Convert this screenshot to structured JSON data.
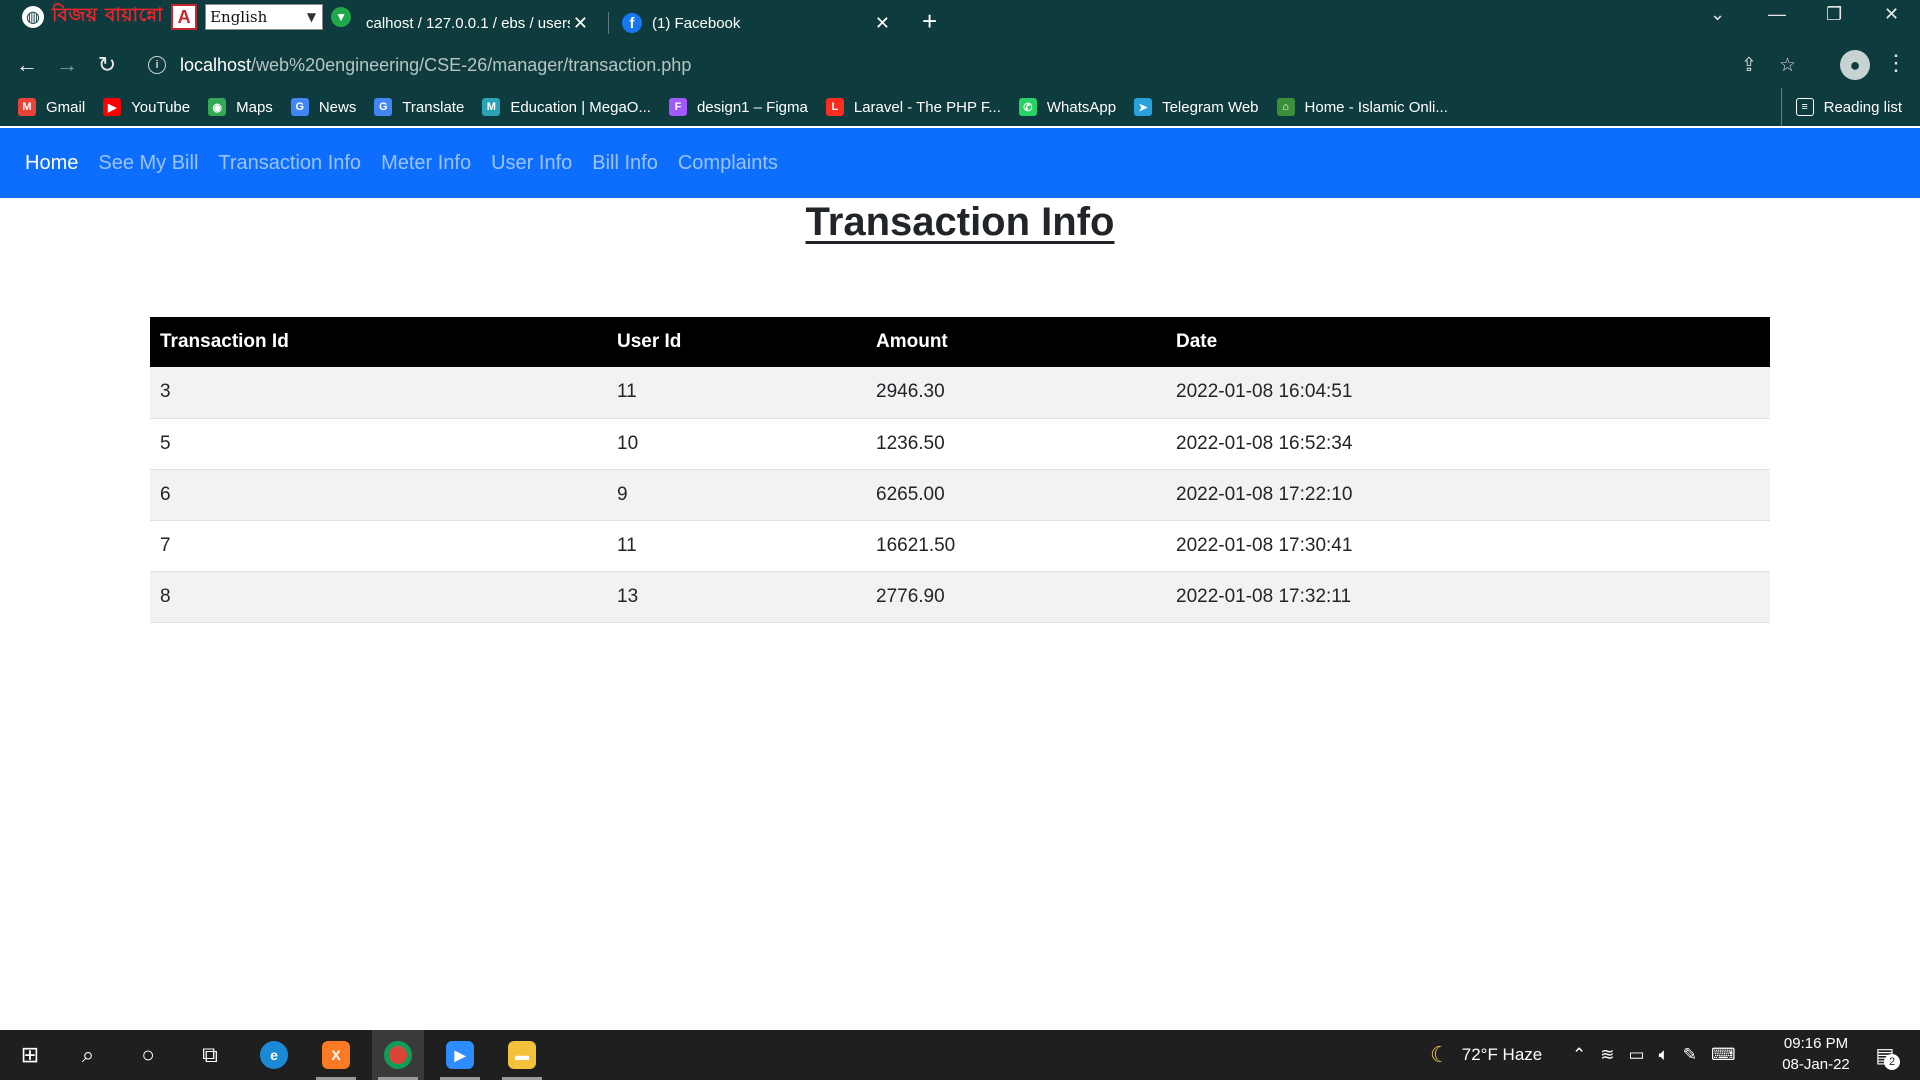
{
  "browser": {
    "extensions": {
      "bangla_brand": "বিজয় বায়ান্নো",
      "language_selected": "English"
    },
    "tabs": [
      {
        "title": "calhost / 127.0.0.1 / ebs / users"
      },
      {
        "title": "(1) Facebook",
        "icon": "f"
      }
    ],
    "address": {
      "url_host": "localhost",
      "url_path": "/web%20engineering/CSE-26/manager/transaction.php"
    },
    "bookmarks": [
      {
        "label": "Gmail",
        "icon_text": "M",
        "color": "#ea4335"
      },
      {
        "label": "YouTube",
        "icon_text": "▶",
        "color": "#ff0000"
      },
      {
        "label": "Maps",
        "icon_text": "◉",
        "color": "#34a853"
      },
      {
        "label": "News",
        "icon_text": "G",
        "color": "#4285f4"
      },
      {
        "label": "Translate",
        "icon_text": "G",
        "color": "#4285f4"
      },
      {
        "label": "Education | MegaO...",
        "icon_text": "M",
        "color": "#2aa3b6"
      },
      {
        "label": "design1 – Figma",
        "icon_text": "F",
        "color": "#a259ff"
      },
      {
        "label": "Laravel - The PHP F...",
        "icon_text": "L",
        "color": "#ff2d20"
      },
      {
        "label": "WhatsApp",
        "icon_text": "✆",
        "color": "#25d366"
      },
      {
        "label": "Telegram Web",
        "icon_text": "➤",
        "color": "#2aa1da"
      },
      {
        "label": "Home - Islamic Onli...",
        "icon_text": "⌂",
        "color": "#3a8f3a"
      }
    ],
    "reading_list": "Reading list"
  },
  "site": {
    "nav": [
      {
        "label": "Home",
        "active": true
      },
      {
        "label": "See My Bill"
      },
      {
        "label": "Transaction Info"
      },
      {
        "label": "Meter Info"
      },
      {
        "label": "User Info"
      },
      {
        "label": "Bill Info"
      },
      {
        "label": "Complaints"
      }
    ],
    "title": "Transaction Info",
    "table": {
      "headers": [
        "Transaction Id",
        "User Id",
        "Amount",
        "Date"
      ],
      "rows": [
        [
          "3",
          "11",
          "2946.30",
          "2022-01-08 16:04:51"
        ],
        [
          "5",
          "10",
          "1236.50",
          "2022-01-08 16:52:34"
        ],
        [
          "6",
          "9",
          "6265.00",
          "2022-01-08 17:22:10"
        ],
        [
          "7",
          "11",
          "16621.50",
          "2022-01-08 17:30:41"
        ],
        [
          "8",
          "13",
          "2776.90",
          "2022-01-08 17:32:11"
        ]
      ]
    }
  },
  "taskbar": {
    "weather": "72°F  Haze",
    "time": "09:16 PM",
    "date": "08-Jan-22",
    "notifications": "2"
  },
  "colors": {
    "browser_chrome": "#0e3b3d",
    "nav_bar": "#0d6efd",
    "table_header": "#000000",
    "taskbar": "#1f1f1f"
  }
}
